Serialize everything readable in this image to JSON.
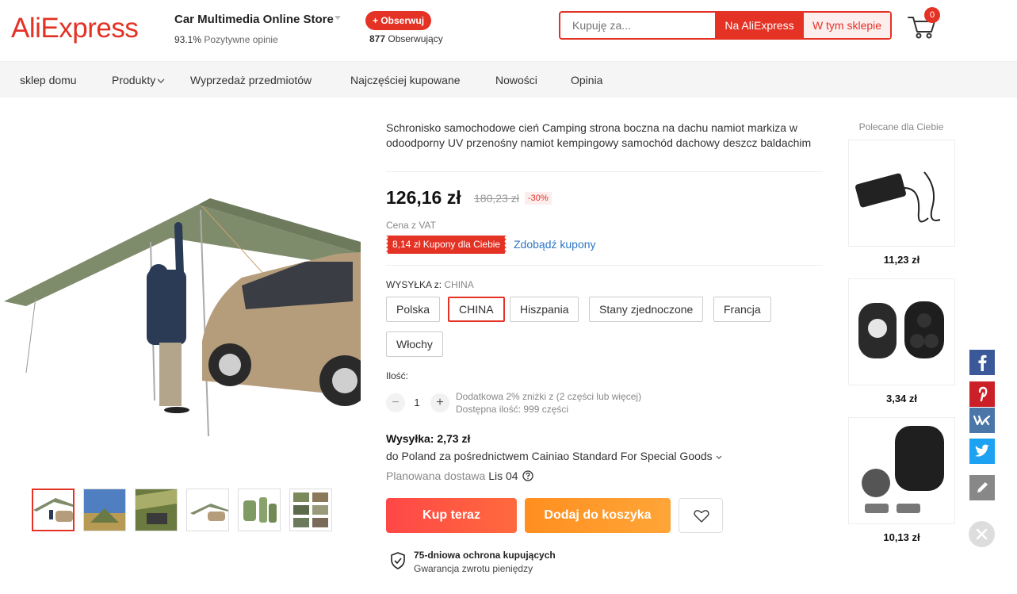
{
  "header": {
    "logo": "AliExpress",
    "store_name": "Car Multimedia Online Store",
    "rating_value": "93.1%",
    "rating_label": "Pozytywne opinie",
    "follow_button": "+ Obserwuj",
    "followers_count": "877",
    "followers_label": "Obserwujący",
    "search_placeholder": "Kupuję za...",
    "search_aliexpress": "Na AliExpress",
    "search_store": "W tym sklepie",
    "cart_count": "0"
  },
  "nav": {
    "items": [
      "sklep domu",
      "Produkty",
      "Wyprzedaż przedmiotów",
      "Najczęściej kupowane",
      "Nowości",
      "Opinia"
    ]
  },
  "product": {
    "title": "Schronisko samochodowe cień Camping strona boczna na dachu namiot markiza w odoodporny UV przenośny namiot kempingowy samochód dachowy deszcz baldachim",
    "price": "126,16 zł",
    "old_price": "180,23 zł",
    "discount": "-30%",
    "vat_note": "Cena z VAT",
    "coupon": "8,14 zł Kupony dla Ciebie",
    "coupon_link": "Zdobądź kupony",
    "shipping_from_label": "WYSYŁKA z:",
    "shipping_from_value": "CHINA",
    "ship_options": [
      "Polska",
      "CHINA",
      "Hiszpania",
      "Stany zjednoczone",
      "Francja",
      "Włochy"
    ],
    "selected_option": "CHINA",
    "quantity_label": "Ilość:",
    "quantity": "1",
    "quantity_minus": "−",
    "quantity_plus": "+",
    "bulk_note": "Dodatkowa 2% zniżki z (2 części lub więcej)",
    "stock_note": "Dostępna ilość: 999 części",
    "shipping_cost": "Wysyłka: 2,73 zł",
    "shipping_via": "do Poland za pośrednictwem Cainiao Standard For Special Goods",
    "delivery_label": "Planowana dostawa",
    "delivery_date": "Lis 04",
    "buy_now": "Kup teraz",
    "add_to_cart": "Dodaj do koszyka",
    "protection_title": "75-dniowa ochrona kupujących",
    "protection_sub": "Gwarancja zwrotu pieniędzy"
  },
  "recommended": {
    "title": "Polecane dla Ciebie",
    "items": [
      {
        "name": "power-adapter",
        "price": "11,23 zł"
      },
      {
        "name": "car-key-shell",
        "price": "3,34 zł"
      },
      {
        "name": "remote-key-case",
        "price": "10,13 zł"
      }
    ]
  },
  "social": [
    "facebook-icon",
    "pinterest-icon",
    "vk-icon",
    "twitter-icon",
    "edit-icon"
  ],
  "colors": {
    "brand": "#e43225",
    "link": "#2e76c4",
    "buy": "#ff4747",
    "cart": "#ff9a2b"
  }
}
